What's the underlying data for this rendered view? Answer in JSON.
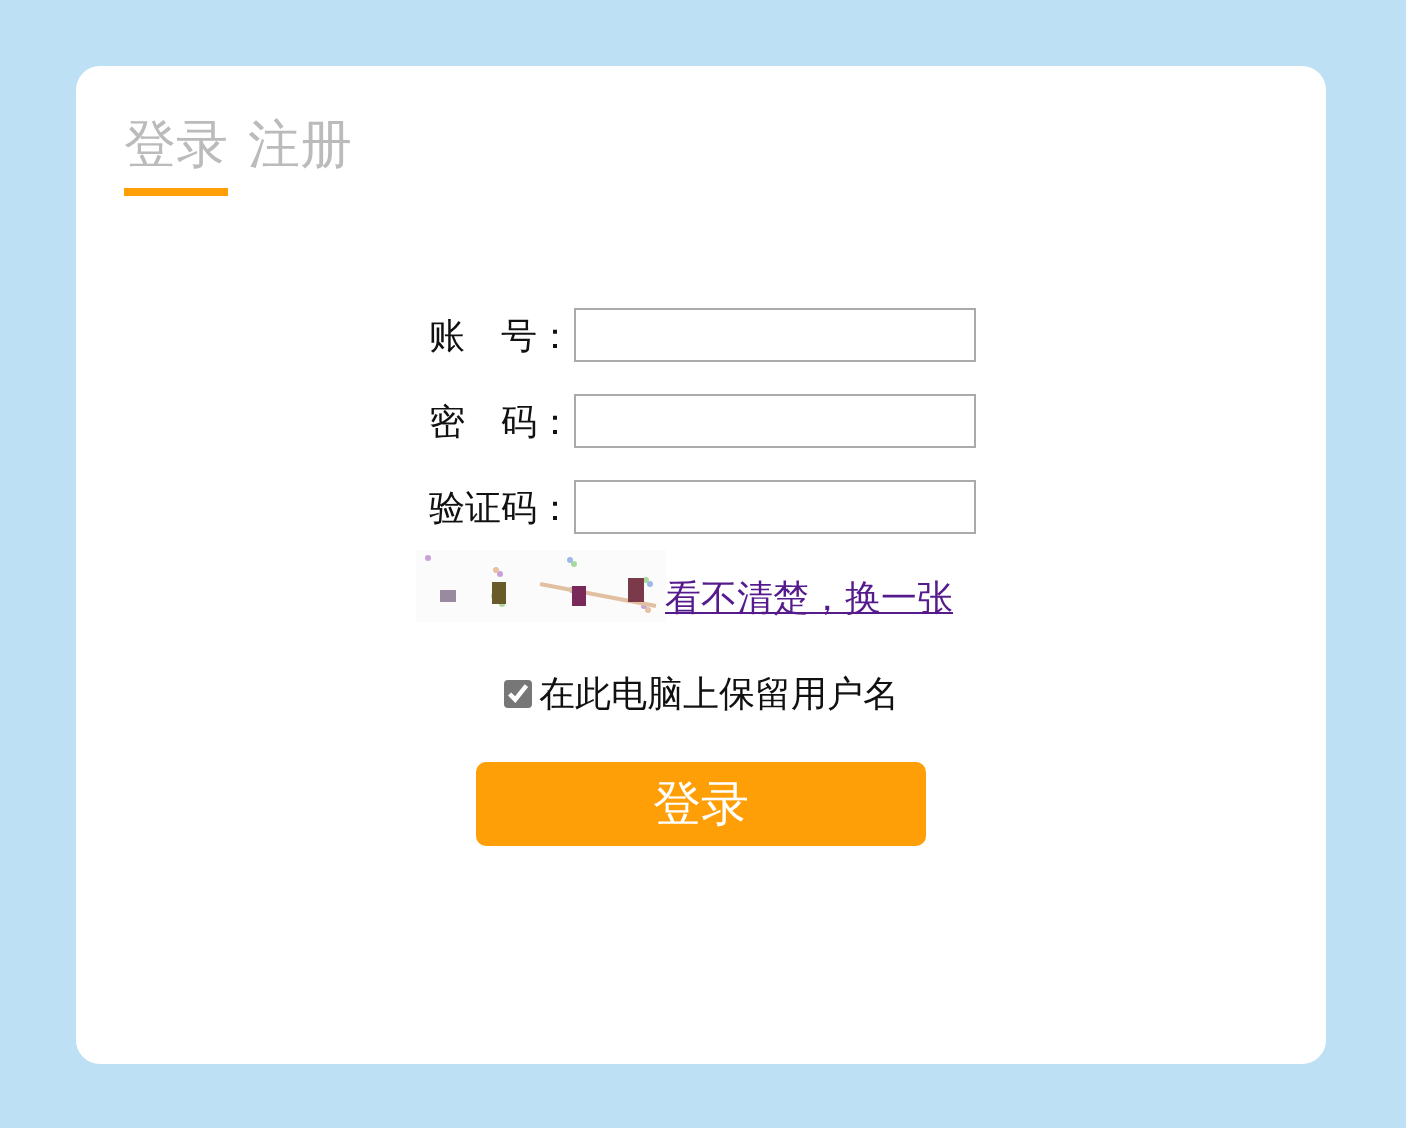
{
  "tabs": [
    {
      "label": "登录",
      "selected": true
    },
    {
      "label": "注册",
      "selected": false
    }
  ],
  "form": {
    "fields": [
      {
        "label": "账　号："
      },
      {
        "label": "密　码："
      },
      {
        "label": "验证码："
      }
    ],
    "captcha": {
      "kind": "picture",
      "refresh_link": "看不清楚，换一张"
    },
    "remember": {
      "label": "在此电脑上保留用户名",
      "checked": true
    },
    "submit": "登录"
  }
}
